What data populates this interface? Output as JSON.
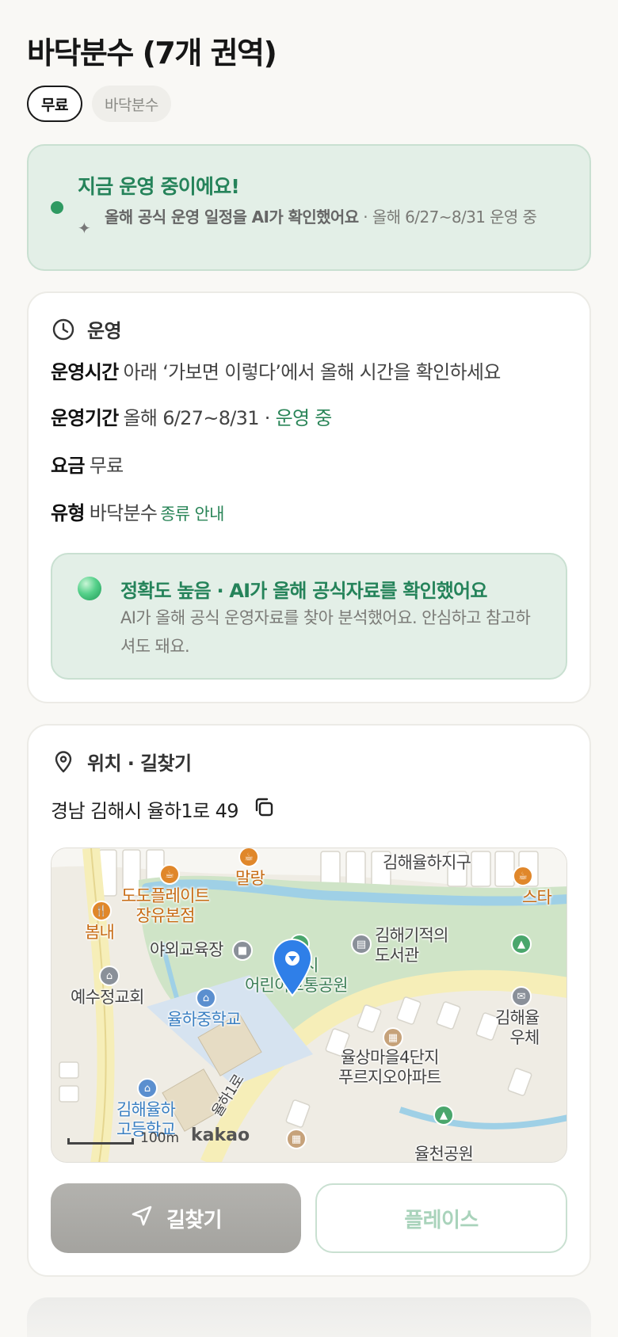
{
  "header": {
    "title": "바닥분수 (7개 권역)",
    "chips": [
      "무료",
      "바닥분수"
    ]
  },
  "status": {
    "title": "지금 운영 중이에요!",
    "sub_bold": "올해 공식 운영 일정을 AI가 확인했어요",
    "sub_rest": " · 올해 6/27~8/31 운영 중"
  },
  "operation": {
    "heading": "운영",
    "hours_key": "운영시간",
    "hours_val": "아래 ‘가보면 이렇다’에서 올해 시간을 확인하세요",
    "period_key": "운영기간",
    "period_val": "올해 6/27~8/31 · ",
    "period_status": "운영 중",
    "fee_key": "요금",
    "fee_val": "무료",
    "type_key": "유형",
    "type_val": "바닥분수",
    "type_link": "종류 안내",
    "accuracy_title": "정확도 높음 · AI가 올해 공식자료를 확인했어요",
    "accuracy_desc": "AI가 올해 공식 운영자료를 찾아 분석했어요. 안심하고 참고하셔도 돼요."
  },
  "location": {
    "heading": "위치 · 길찾기",
    "address": "경남 김해시 율하1로 49",
    "map": {
      "labels": {
        "gimhae_yulha": "김해율하지구",
        "malang": "말랑",
        "starbucks": "스타",
        "dodoplate": "도도플레이트\n장유본점",
        "bomnae": "봄내",
        "yaoe": "야외교육장",
        "park": "김해시\n어린이교통공원",
        "library": "김해기적의\n도서관",
        "church": "예수정교회",
        "middle_school": "율하중학교",
        "post": "김해율\n우체",
        "apt": "율상마을4단지\n푸르지오아파트",
        "high_school": "김해율하\n고등학교",
        "road": "율하1로",
        "yulcheon": "율천공원",
        "scale": "100m",
        "brand": "kakao"
      }
    }
  },
  "actions": {
    "route": "길찾기",
    "place": "플레이스"
  }
}
